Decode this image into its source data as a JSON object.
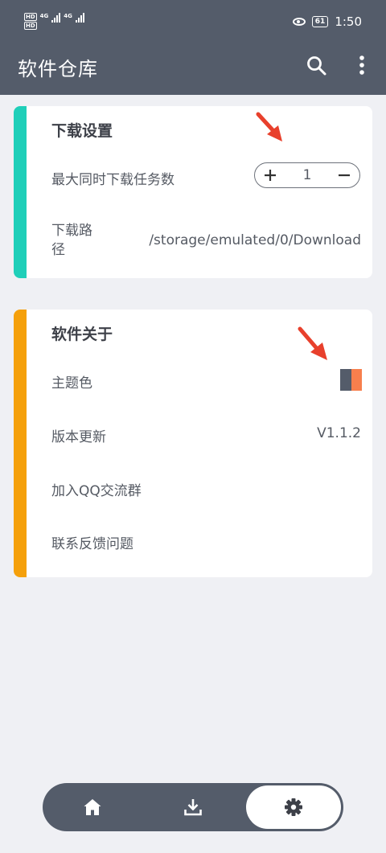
{
  "status_bar": {
    "hd1": "HD",
    "hd2": "HD",
    "signal1": "4G",
    "signal2": "4G",
    "battery": "61",
    "time": "1:50"
  },
  "app_bar": {
    "title": "软件仓库",
    "search_icon": "search-icon",
    "more_icon": "more-vert-icon"
  },
  "download_settings": {
    "heading": "下载设置",
    "accent_color": "#1fcfb9",
    "max_tasks_label": "最大同时下载任务数",
    "max_tasks_value": "1",
    "plus_icon": "plus-icon",
    "minus_icon": "minus-icon",
    "path_label": "下载路\n径",
    "path_value": "/storage/emulated/0/Download"
  },
  "about": {
    "heading": "软件关于",
    "accent_color": "#f5a00b",
    "theme_label": "主题色",
    "theme_colors": [
      "#545c6a",
      "#f77f4d"
    ],
    "version_label": "版本更新",
    "version_value": "V1.1.2",
    "qq_label": "加入QQ交流群",
    "feedback_label": "联系反馈问题"
  },
  "annotation_color": "#e8402c",
  "bottom_nav": {
    "items": [
      {
        "icon": "home-icon",
        "active": false
      },
      {
        "icon": "download-icon",
        "active": false
      },
      {
        "icon": "settings-gear-icon",
        "active": true
      }
    ]
  }
}
